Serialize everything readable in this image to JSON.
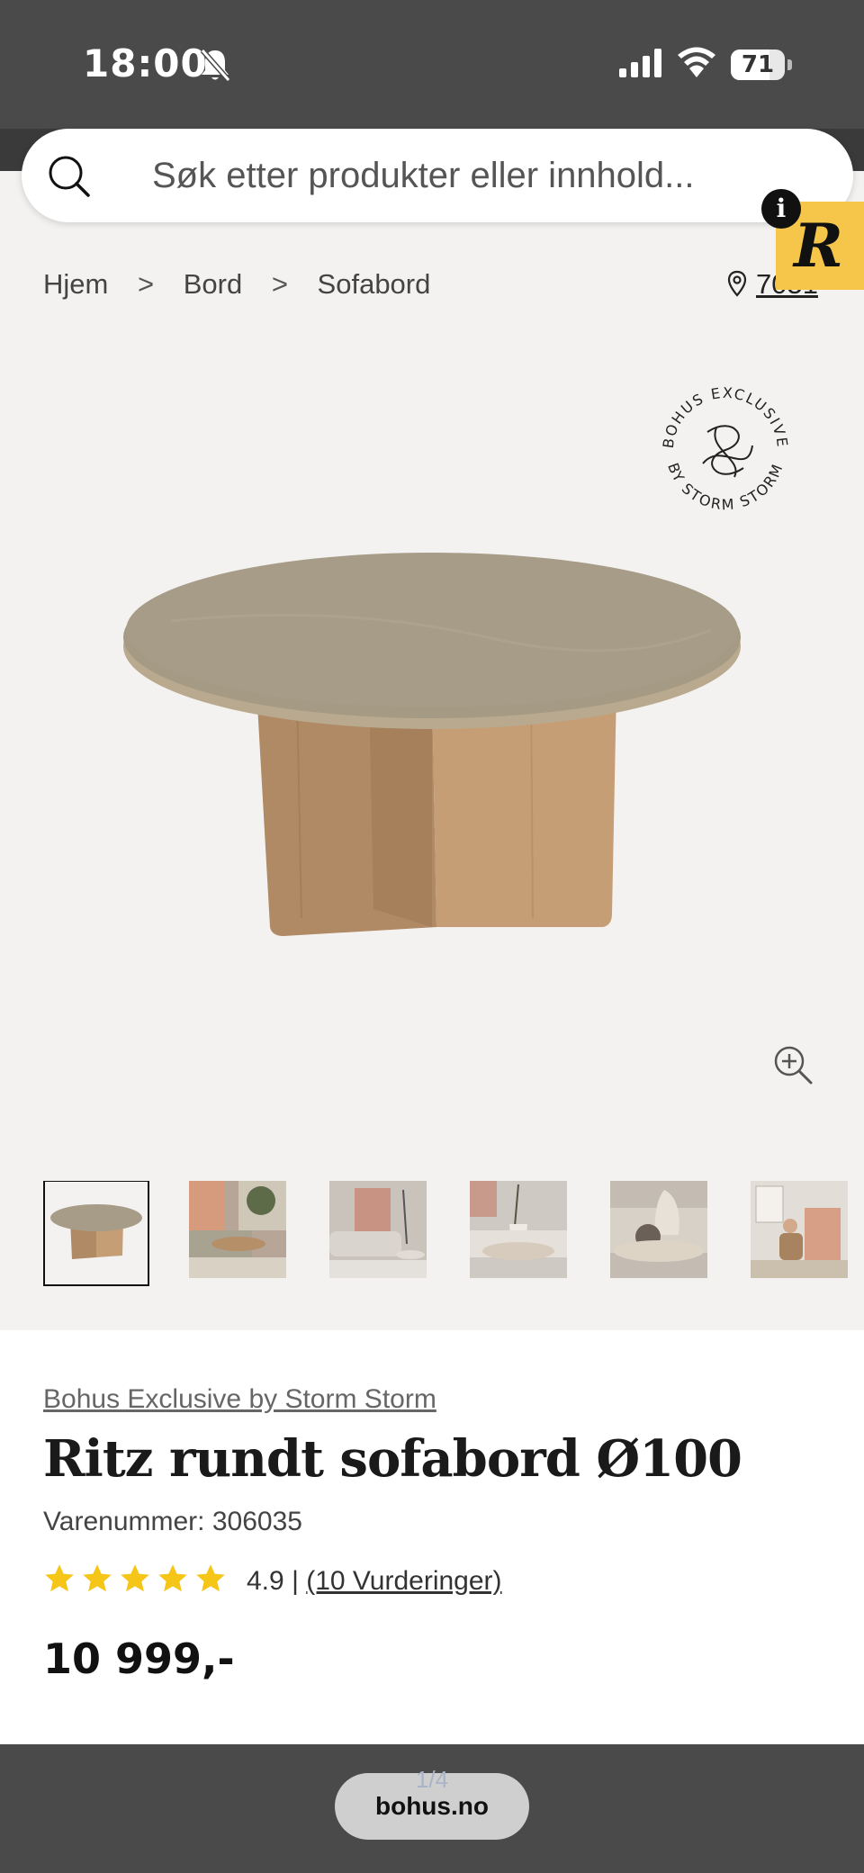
{
  "status_bar": {
    "time": "18:00",
    "battery": "71",
    "battery_level": 0.71
  },
  "search": {
    "placeholder": "Søk etter produkter eller innhold..."
  },
  "overlay": {
    "info_label": "i",
    "logo_letter": "R"
  },
  "breadcrumb": {
    "items": [
      "Hjem",
      "Bord",
      "Sofabord"
    ],
    "separator": ">"
  },
  "location": {
    "postcode": "7051"
  },
  "seal": {
    "text_top": "BOHUS EXCLUSIVE",
    "text_bottom": "BY STORM STORM"
  },
  "product": {
    "brand": "Bohus Exclusive by Storm Storm",
    "title": "Ritz rundt sofabord Ø100",
    "sku": "Varenummer: 306035",
    "rating": {
      "stars": 5,
      "value": "4.9",
      "separator": "|",
      "reviews_label": "(10 Vurderinger)"
    },
    "price": "10 999,-"
  },
  "thumbnails": [
    {
      "name": "table-only",
      "active": true
    },
    {
      "name": "living-room-1",
      "active": false
    },
    {
      "name": "living-room-2",
      "active": false
    },
    {
      "name": "living-room-3",
      "active": false
    },
    {
      "name": "living-room-4",
      "active": false
    },
    {
      "name": "living-room-5",
      "active": false
    }
  ],
  "browser": {
    "page_indicator": "1/4",
    "url": "bohus.no"
  },
  "colors": {
    "status_bar": "#4a4a4a",
    "star": "#f5c518",
    "logo_bg": "#f6c64a",
    "page_bg": "#f4f2f0"
  }
}
